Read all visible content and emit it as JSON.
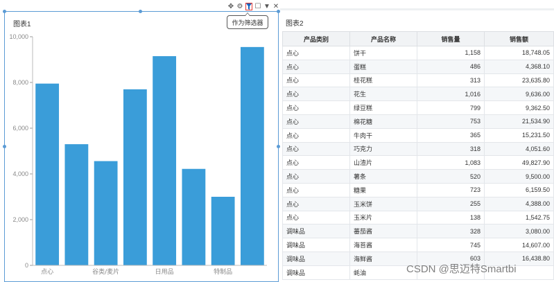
{
  "chart_panel": {
    "title": "图表1",
    "toolbar": {
      "move_icon": "✥",
      "settings_icon": "⚙",
      "filter_icon": "Y",
      "expand_icon": "☐",
      "more_icon": "▼",
      "close_icon": "✕"
    },
    "tooltip": "作为筛选器"
  },
  "chart_data": {
    "type": "bar",
    "title": "",
    "xlabel": "",
    "ylabel": "",
    "ylim": [
      0,
      10000
    ],
    "y_ticks": [
      "0",
      "2,000",
      "4,000",
      "6,000",
      "8,000",
      "10,000"
    ],
    "x_tick_labels": [
      {
        "label": "点心",
        "at": 0.5
      },
      {
        "label": "谷类/麦片",
        "at": 2.5
      },
      {
        "label": "日用品",
        "at": 4.5
      },
      {
        "label": "特制品",
        "at": 6.5
      }
    ],
    "values": [
      7950,
      5300,
      4560,
      7700,
      9150,
      4220,
      3000,
      9550
    ],
    "bar_color": "#3a9dd9",
    "grid": false
  },
  "table_panel": {
    "title": "图表2",
    "columns": [
      "产品类别",
      "产品名称",
      "销售量",
      "销售额"
    ],
    "rows": [
      [
        "点心",
        "饼干",
        "1,158",
        "18,748.05"
      ],
      [
        "点心",
        "蛋糕",
        "486",
        "4,368.10"
      ],
      [
        "点心",
        "桂花糕",
        "313",
        "23,635.80"
      ],
      [
        "点心",
        "花生",
        "1,016",
        "9,636.00"
      ],
      [
        "点心",
        "绿豆糕",
        "799",
        "9,362.50"
      ],
      [
        "点心",
        "棉花糖",
        "753",
        "21,534.90"
      ],
      [
        "点心",
        "牛肉干",
        "365",
        "15,231.50"
      ],
      [
        "点心",
        "巧克力",
        "318",
        "4,051.60"
      ],
      [
        "点心",
        "山渣片",
        "1,083",
        "49,827.90"
      ],
      [
        "点心",
        "薯条",
        "520",
        "9,500.00"
      ],
      [
        "点心",
        "糖果",
        "723",
        "6,159.50"
      ],
      [
        "点心",
        "玉米饼",
        "255",
        "4,388.00"
      ],
      [
        "点心",
        "玉米片",
        "138",
        "1,542.75"
      ],
      [
        "调味品",
        "蕃茄酱",
        "328",
        "3,080.00"
      ],
      [
        "调味品",
        "海苔酱",
        "745",
        "14,607.00"
      ],
      [
        "调味品",
        "海鲜酱",
        "603",
        "16,438.80"
      ],
      [
        "调味品",
        "蚝油",
        "",
        ""
      ]
    ]
  },
  "watermark": "CSDN @思迈特Smartbi"
}
